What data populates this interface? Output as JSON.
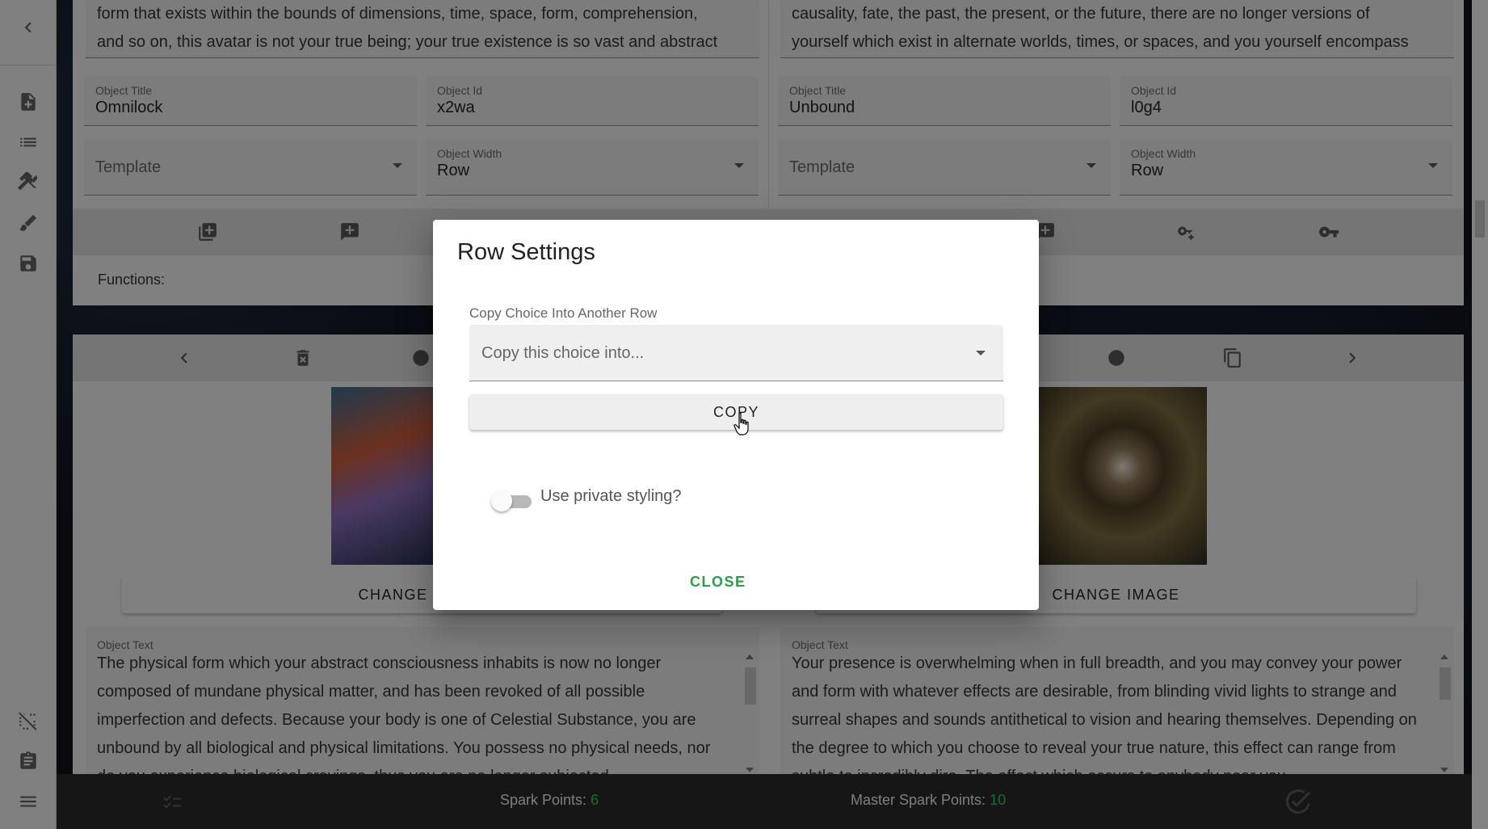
{
  "rail": {
    "icons": [
      "chevron-left-icon",
      "new-document-icon",
      "list-icon",
      "tools-icon",
      "brush-icon",
      "save-icon",
      "grid-off-icon",
      "clipboard-icon",
      "menu-icon"
    ]
  },
  "left_card": {
    "text_top": "form that exists within the bounds of dimensions, time, space, form, comprehension, and so on, this avatar is not your true being; your true existence is so vast and abstract",
    "title_label": "Object Title",
    "title_value": "Omnilock",
    "id_label": "Object Id",
    "id_value": "x2wa",
    "template_placeholder": "Template",
    "width_label": "Object Width",
    "width_value": "Row",
    "functions_label": "Functions:",
    "change_image_label": "CHANGE IMAGE",
    "object_text_label": "Object Text",
    "object_text": "The physical form which your abstract consciousness inhabits is now no longer composed of mundane physical matter, and has been revoked of all possible imperfection and defects. Because your body is one of Celestial Substance, you are unbound by all biological and physical limitations. You possess no physical needs, nor do you experience biological cravings, thus you are no longer subjected"
  },
  "right_card": {
    "text_top": "causality, fate, the past, the present, or the future, there are no longer versions of yourself which exist in alternate worlds, times, or spaces, and you yourself encompass",
    "title_label": "Object Title",
    "title_value": "Unbound",
    "id_label": "Object Id",
    "id_value": "l0g4",
    "template_placeholder": "Template",
    "width_label": "Object Width",
    "width_value": "Row",
    "change_image_label": "CHANGE IMAGE",
    "object_text_label": "Object Text",
    "object_text": "Your presence is overwhelming when in full breadth, and you may convey your power and form with whatever effects are desirable, from blinding vivid lights to strange and surreal shapes and sounds antithetical to vision and hearing themselves. Depending on the degree to which you choose to reveal your true nature, this effect can range from subtle to incredibly dire. The effect which occurs to anybody near you"
  },
  "bottombar": {
    "spark_label": "Spark Points:",
    "spark_value": "6",
    "master_label": "Master Spark Points:",
    "master_value": "10"
  },
  "dialog": {
    "title": "Row Settings",
    "copy_label": "Copy Choice Into Another Row",
    "copy_placeholder": "Copy this choice into...",
    "copy_button": "COPY",
    "private_styling_label": "Use private styling?",
    "private_styling_on": false,
    "close_button": "CLOSE"
  },
  "colors": {
    "accent_green": "#2e9c4a",
    "points_green": "#39c25a"
  }
}
